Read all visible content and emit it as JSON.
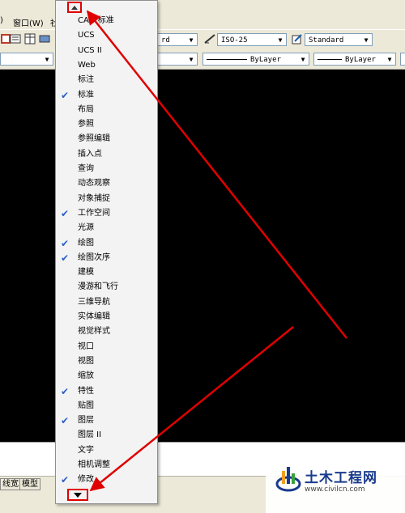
{
  "menubar": {
    "items": [
      ")",
      "窗口(W)",
      "社"
    ]
  },
  "toolbar1": {
    "text_style_combo": "rd",
    "dim_style_combo": "ISO-25",
    "table_style_combo": "Standard"
  },
  "toolbar2": {
    "linetype_combo": "ByLayer",
    "lineweight_combo": "ByLayer"
  },
  "statusbar": {
    "lineweight_btn": "线宽",
    "model_btn": "模型"
  },
  "menu": {
    "items": [
      {
        "label": "CAD 标准",
        "checked": false
      },
      {
        "label": "UCS",
        "checked": false
      },
      {
        "label": "UCS II",
        "checked": false
      },
      {
        "label": "Web",
        "checked": false
      },
      {
        "label": "标注",
        "checked": false
      },
      {
        "label": "标准",
        "checked": true
      },
      {
        "label": "布局",
        "checked": false
      },
      {
        "label": "参照",
        "checked": false
      },
      {
        "label": "参照编辑",
        "checked": false
      },
      {
        "label": "插入点",
        "checked": false
      },
      {
        "label": "查询",
        "checked": false
      },
      {
        "label": "动态观察",
        "checked": false
      },
      {
        "label": "对象捕捉",
        "checked": false
      },
      {
        "label": "工作空间",
        "checked": true
      },
      {
        "label": "光源",
        "checked": false
      },
      {
        "label": "绘图",
        "checked": true
      },
      {
        "label": "绘图次序",
        "checked": true
      },
      {
        "label": "建模",
        "checked": false
      },
      {
        "label": "漫游和飞行",
        "checked": false
      },
      {
        "label": "三维导航",
        "checked": false
      },
      {
        "label": "实体编辑",
        "checked": false
      },
      {
        "label": "视觉样式",
        "checked": false
      },
      {
        "label": "视口",
        "checked": false
      },
      {
        "label": "视图",
        "checked": false
      },
      {
        "label": "缩放",
        "checked": false
      },
      {
        "label": "特性",
        "checked": true
      },
      {
        "label": "贴图",
        "checked": false
      },
      {
        "label": "图层",
        "checked": true
      },
      {
        "label": "图层 II",
        "checked": false
      },
      {
        "label": "文字",
        "checked": false
      },
      {
        "label": "相机调整",
        "checked": false
      },
      {
        "label": "修改",
        "checked": true
      }
    ]
  },
  "check_glyph": "✔",
  "watermark": {
    "title": "土木工程网",
    "url": "www.civilcn.com"
  },
  "colors": {
    "annotation_red": "#e00000",
    "check_blue": "#2a5fc8"
  }
}
